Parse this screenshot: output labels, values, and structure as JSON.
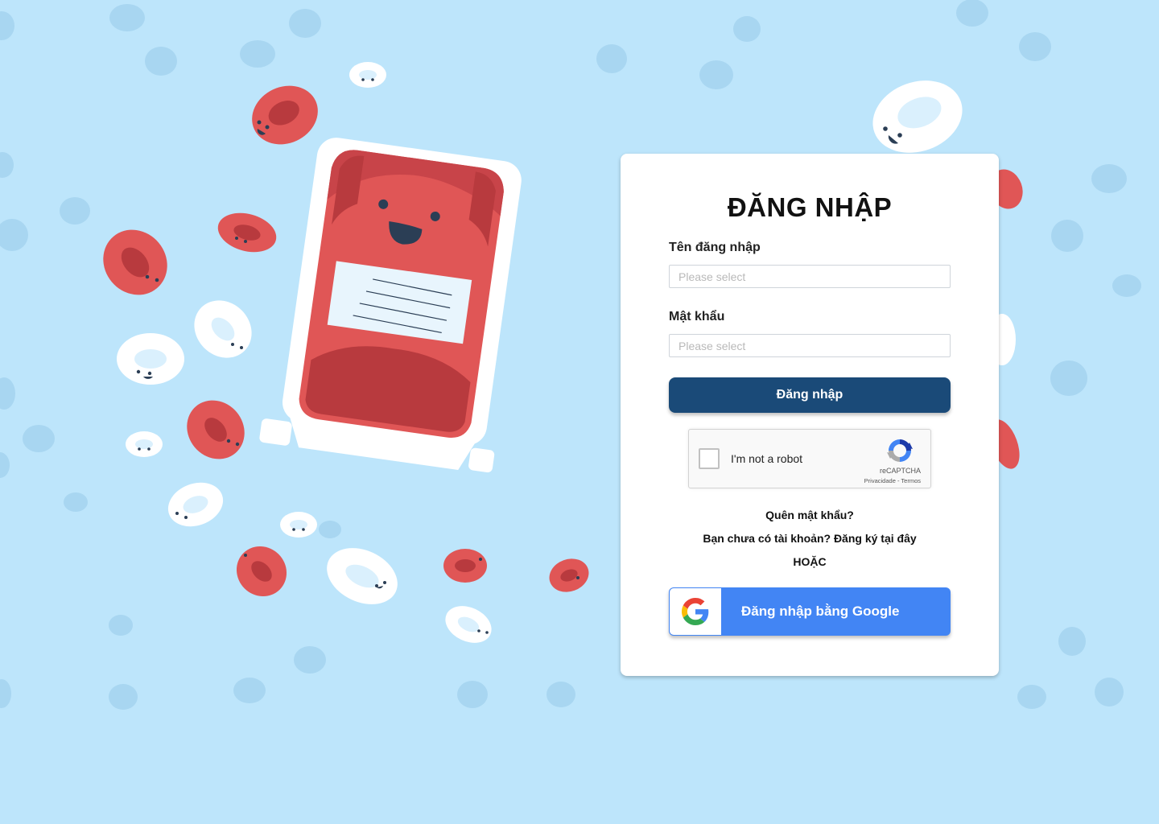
{
  "login": {
    "title": "ĐĂNG NHẬP",
    "username_label": "Tên đăng nhập",
    "username_placeholder": "Please select",
    "password_label": "Mật khẩu",
    "password_placeholder": "Please select",
    "submit_label": "Đăng nhập",
    "forgot_password": "Quên mật khẩu?",
    "no_account_text": "Bạn chưa có tài khoản? Đăng ký",
    "register_link": "tại đây",
    "or_divider": "HOẶC",
    "google_label": "Đăng nhập bằng Google"
  },
  "recaptcha": {
    "label": "I'm not a robot",
    "brand": "reCAPTCHA",
    "privacy": "Privacidade",
    "separator": " - ",
    "terms": "Termos"
  },
  "colors": {
    "background": "#bde5fb",
    "primary_button": "#1a4a78",
    "google_button": "#4285f4",
    "red_cell": "#e05555",
    "white_cell": "#ffffff"
  },
  "icons": {
    "google": "google-g-icon",
    "recaptcha": "recaptcha-logo-icon",
    "illustration": "blood-bag-mascot"
  }
}
